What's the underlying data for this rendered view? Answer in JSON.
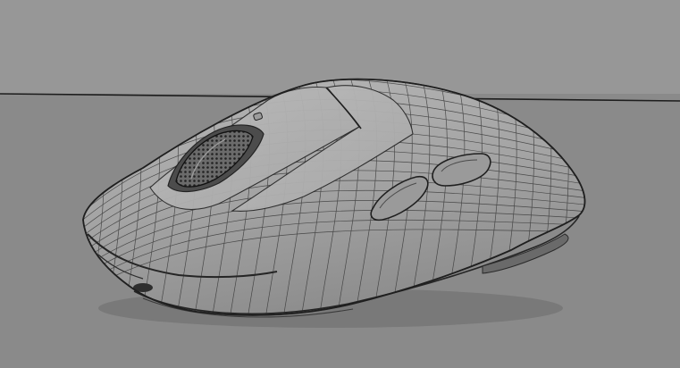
{
  "scene": {
    "subject": "wireless-mouse-3d-wireframe",
    "colors": {
      "backdrop": "#979797",
      "floor": "#8a8a8a",
      "horizon_line": "#1d1d1d",
      "body": "#a2a2a2",
      "body_dark": "#868686",
      "wire": "#2b2b2b"
    }
  }
}
